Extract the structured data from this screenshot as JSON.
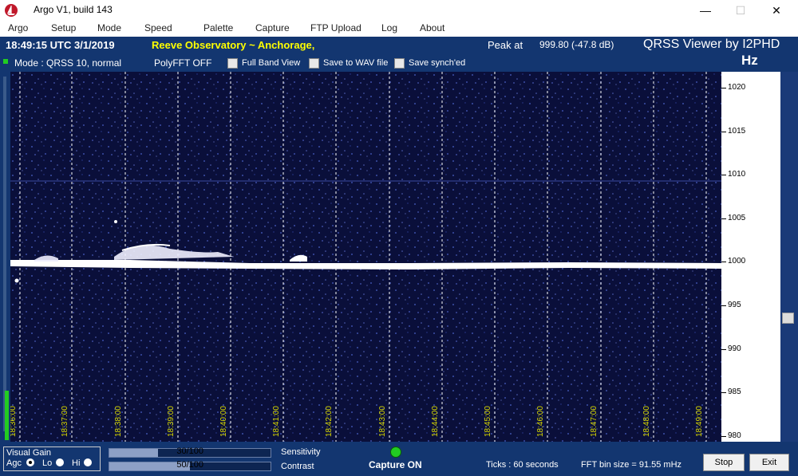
{
  "window": {
    "title": "Argo V1, build 143",
    "minimize": "—",
    "maximize": "☐",
    "close": "✕"
  },
  "menu": [
    "Argo",
    "Setup",
    "Mode",
    "Speed",
    "Palette",
    "Capture",
    "FTP Upload",
    "Log",
    "About"
  ],
  "header": {
    "time_date": "18:49:15 UTC  3/1/2019",
    "station": "Reeve Observatory ~ Anchorage,",
    "peak_label": "Peak at",
    "peak_value": "999.80 (-47.8 dB)",
    "viewer": "QRSS Viewer by I2PHD",
    "unit": "Hz",
    "mode": "Mode : QRSS 10, normal",
    "polyfft": "PolyFFT OFF",
    "full_band": "Full Band View",
    "save_wav": "Save to WAV file",
    "save_synch": "Save synch'ed"
  },
  "freq_axis": {
    "labels": [
      "1020",
      "1015",
      "1010",
      "1005",
      "1000",
      "995",
      "990",
      "985",
      "980"
    ]
  },
  "time_axis": {
    "labels": [
      "18:36:00",
      "18:37:00",
      "18:38:00",
      "18:39:00",
      "18:40:00",
      "18:41:00",
      "18:42:00",
      "18:43:00",
      "18:44:00",
      "18:45:00",
      "18:46:00",
      "18:47:00",
      "18:48:00",
      "18:49:00"
    ]
  },
  "bottom": {
    "visual_gain": "Visual Gain",
    "agc": "Agc",
    "lo": "Lo",
    "hi": "Hi",
    "sensitivity_value": "30/100",
    "sensitivity_fraction": 0.3,
    "sensitivity_label": "Sensitivity",
    "contrast_value": "50/100",
    "contrast_fraction": 0.5,
    "contrast_label": "Contrast",
    "capture": "Capture ON",
    "ticks": "Ticks  : 60 seconds",
    "fft_bin": "FFT bin size = 91.55 mHz",
    "stop": "Stop",
    "exit": "Exit"
  },
  "colors": {
    "background": "#133670",
    "header_yellow": "#ffff00",
    "capture_led": "#22cc22",
    "signal": "#ffffff"
  }
}
